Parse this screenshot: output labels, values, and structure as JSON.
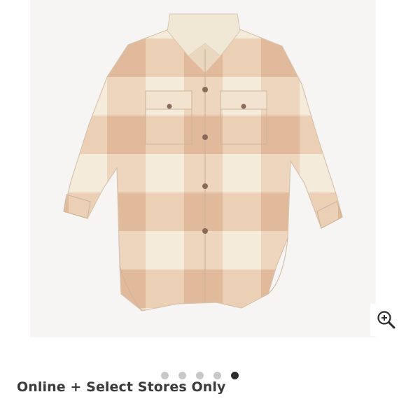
{
  "product": {
    "image_alt": "Plaid shirt jacket",
    "availability": "Online + Select Stores Only",
    "colors": {
      "tan": "#e8c4a8",
      "cream": "#f3ead7",
      "button": "#8a6a58"
    }
  },
  "gallery": {
    "dot_count": 5,
    "active_index": 4,
    "zoom_icon": "zoom-in-icon"
  }
}
